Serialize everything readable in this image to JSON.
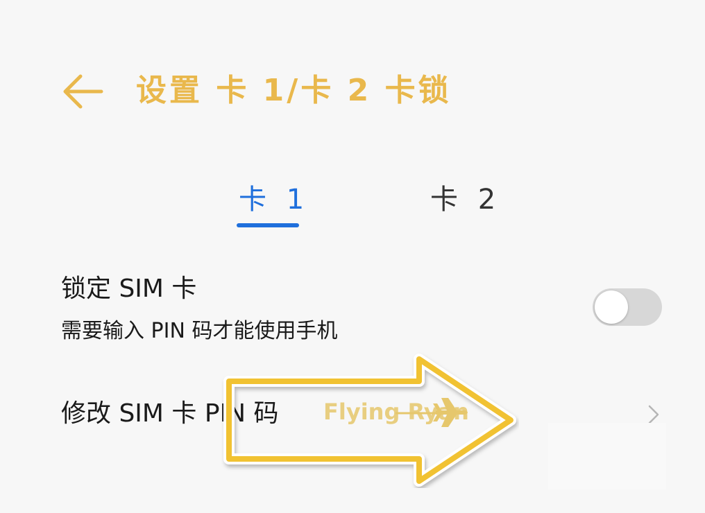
{
  "header": {
    "back_icon": "arrow-left-icon",
    "title": "设置 卡 1/卡 2 卡锁"
  },
  "tabs": [
    {
      "label": "卡 1",
      "selected": true
    },
    {
      "label": "卡 2",
      "selected": false
    }
  ],
  "settings": {
    "lock_sim": {
      "title": "锁定 SIM 卡",
      "subtitle": "需要输入 PIN 码才能使用手机",
      "enabled": false
    },
    "change_pin": {
      "title": "修改 SIM 卡 PIN 码",
      "chevron_icon": "chevron-right-icon"
    }
  },
  "annotation": {
    "watermark_text": "Flying Ryan",
    "icon": "airplane-icon"
  },
  "colors": {
    "title": "#e9b84c",
    "accent": "#1f6fdc",
    "text": "#1a1a1a",
    "toggle_off": "#d7d7d7",
    "arrow_outline": "#f1c232",
    "background": "#f7f7f7"
  }
}
